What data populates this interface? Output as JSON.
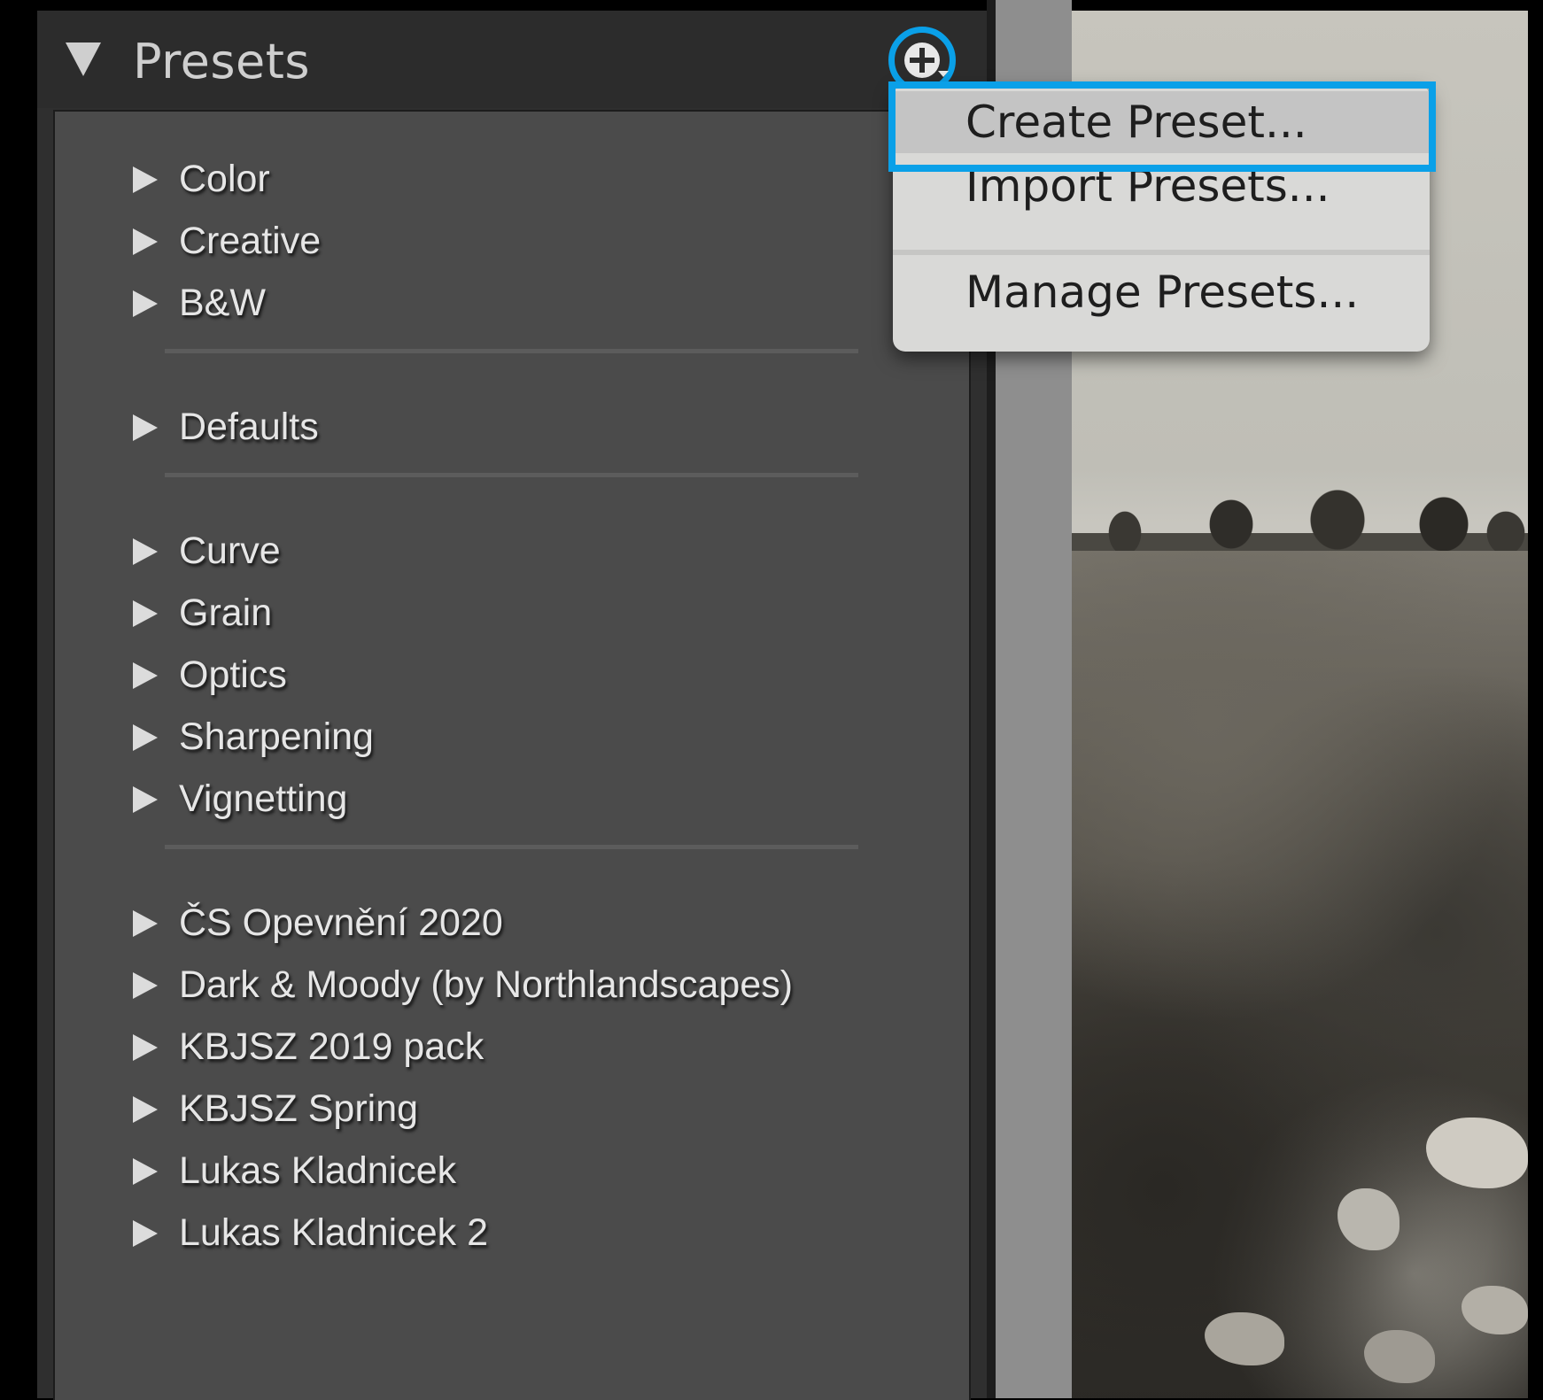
{
  "panel": {
    "title": "Presets"
  },
  "groups": [
    {
      "label": "Color"
    },
    {
      "label": "Creative"
    },
    {
      "label": "B&W"
    },
    {
      "label": "Defaults"
    },
    {
      "label": "Curve"
    },
    {
      "label": "Grain"
    },
    {
      "label": "Optics"
    },
    {
      "label": "Sharpening"
    },
    {
      "label": "Vignetting"
    },
    {
      "label": "ČS Opevnění 2020"
    },
    {
      "label": "Dark & Moody (by Northlandscapes)"
    },
    {
      "label": "KBJSZ 2019 pack"
    },
    {
      "label": "KBJSZ Spring"
    },
    {
      "label": "Lukas Kladnicek"
    },
    {
      "label": "Lukas Kladnicek 2"
    }
  ],
  "menu": {
    "create": "Create Preset...",
    "import": "Import Presets...",
    "manage": "Manage Presets..."
  },
  "icons": {
    "add": "plus-circle-icon",
    "collapse": "triangle-down-icon",
    "expand": "triangle-right-icon"
  },
  "colors": {
    "highlight": "#0aa0e8",
    "panel_bg": "#4b4b4b",
    "menu_bg": "#d9d9d7"
  }
}
